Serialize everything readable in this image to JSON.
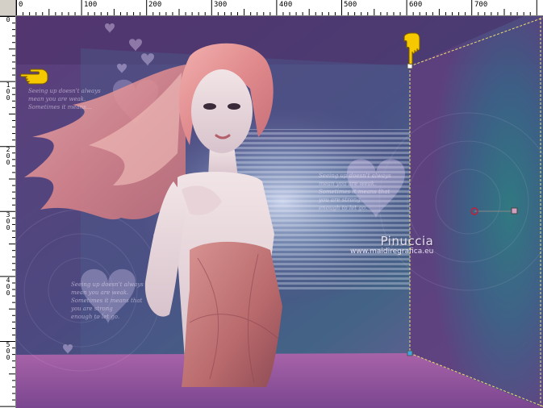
{
  "rulers": {
    "horizontal": [
      "0",
      "100",
      "200",
      "300",
      "400",
      "500",
      "600",
      "700"
    ],
    "vertical": [
      "0",
      "1\n0\n0",
      "2\n0\n0",
      "3\n0\n0",
      "4\n0\n0",
      "5\n0\n0"
    ]
  },
  "canvas": {
    "watermark_title": "Pinuccia",
    "watermark_url": "www.maidiregrafica.eu",
    "script_lines": {
      "center": "Seeing up doesn't always\nmean you are weak.\nSometimes it means that\nyou are strong\nenough to let go.",
      "left_top": "Seeing up doesn't always\nmean you are weak.\nSometimes it means...",
      "left_bottom": "Seeing up doesn't always\nmean you are weak.\nSometimes it means that\nyou are strong\nenough to let go."
    }
  },
  "colors": {
    "accent": "#6a4a86",
    "selection": "#f0e070",
    "pointer": "#f5c800"
  },
  "icons": [
    "hand-pointer-icon",
    "hand-pointer-down-icon",
    "rotation-handle-icon"
  ]
}
